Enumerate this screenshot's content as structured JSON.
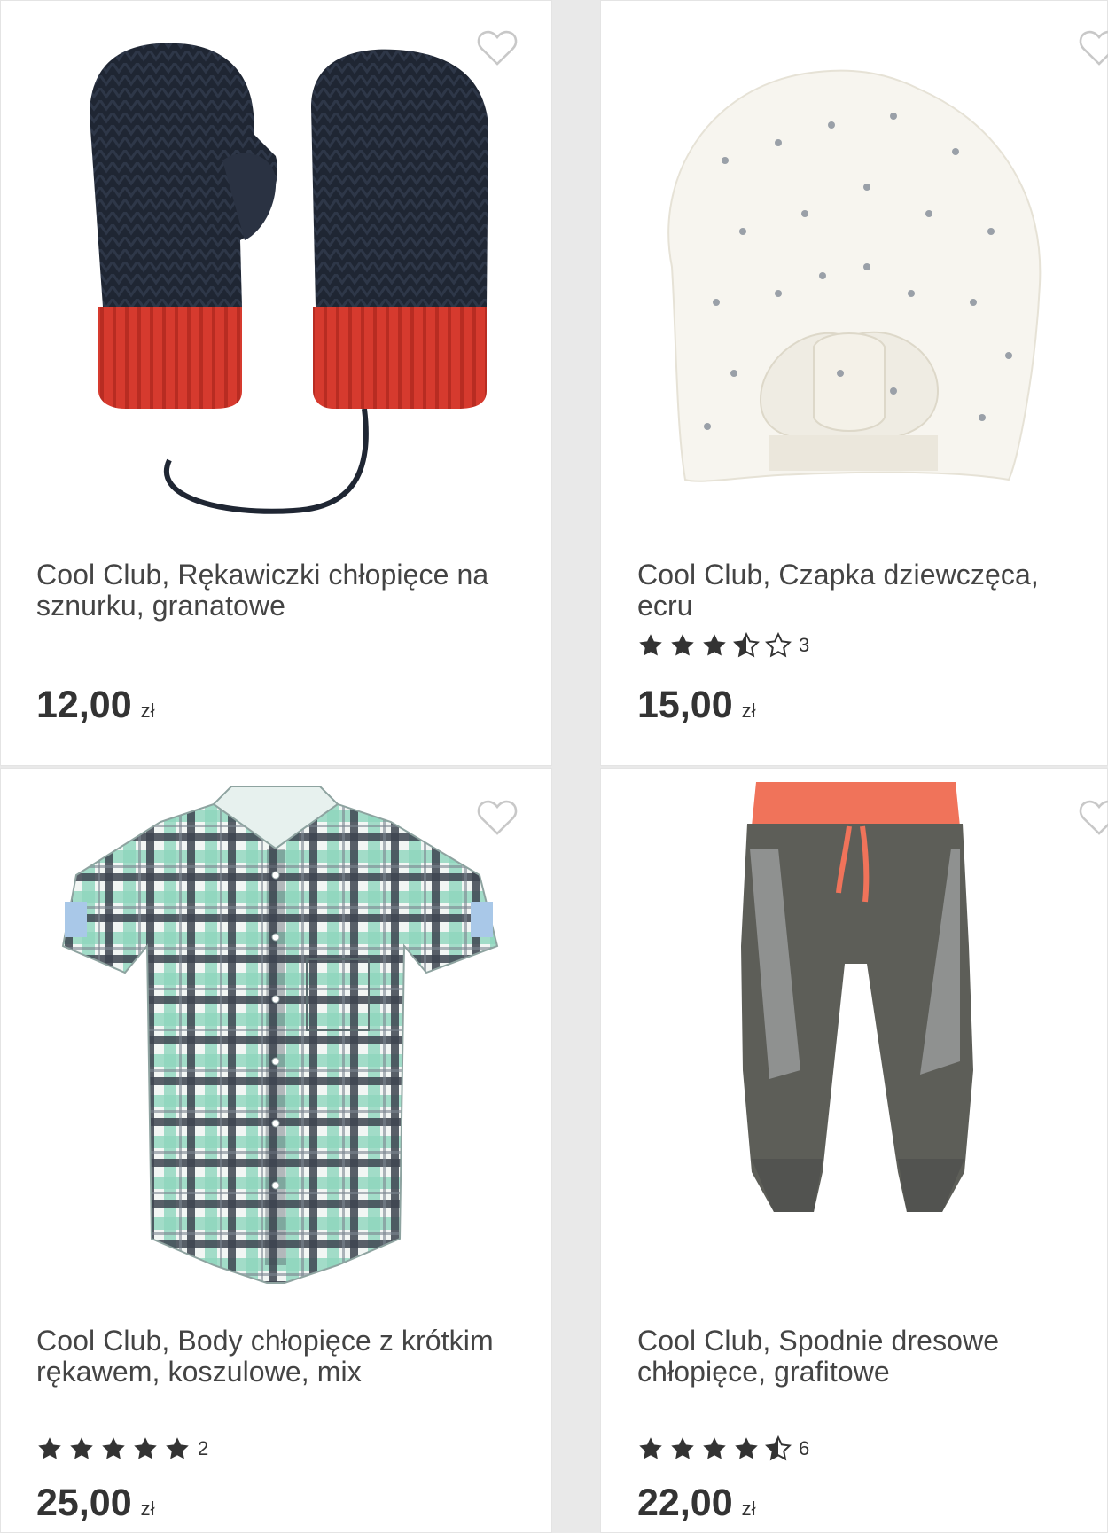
{
  "products": [
    {
      "title": "Cool Club, Rękawiczki chłopięce na sznurku, granatowe",
      "price": "12,00",
      "currency": "zł",
      "image_icon": "mittens-image"
    },
    {
      "title": "Cool Club, Czapka dziewczęca, ecru",
      "rating": 3.5,
      "rating_count": "3",
      "price": "15,00",
      "currency": "zł",
      "image_icon": "turban-hat-image"
    },
    {
      "title": "Cool Club, Body chłopięce z krótkim rękawem, koszulowe, mix",
      "rating": 5,
      "rating_count": "2",
      "price": "25,00",
      "currency": "zł",
      "image_icon": "plaid-bodysuit-image"
    },
    {
      "title": "Cool Club, Spodnie dresowe chłopięce, grafitowe",
      "rating": 4.5,
      "rating_count": "6",
      "price": "22,00",
      "currency": "zł",
      "image_icon": "sweatpants-image"
    }
  ],
  "colors": {
    "text": "#333333",
    "star": "#333333",
    "heart": "#c8c8c8",
    "background": "#e9e9e9"
  }
}
